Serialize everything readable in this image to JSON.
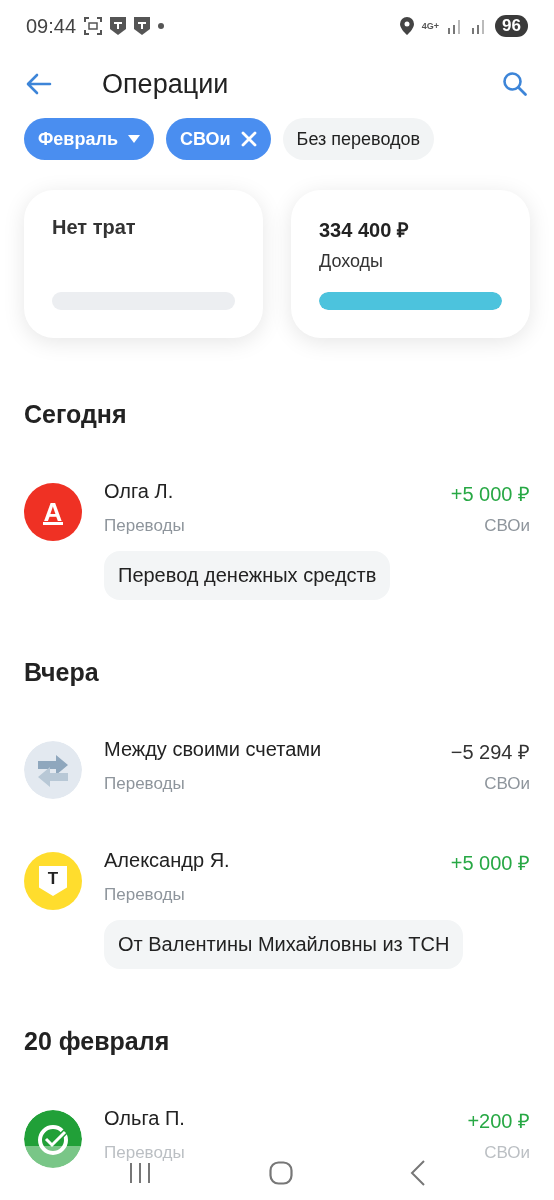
{
  "status_bar": {
    "time": "09:44",
    "network": "4G+",
    "battery": "96"
  },
  "header": {
    "title": "Операции"
  },
  "filters": [
    {
      "label": "Февраль",
      "selected": true,
      "kind": "dropdown"
    },
    {
      "label": "СВОи",
      "selected": true,
      "kind": "removable"
    },
    {
      "label": "Без переводов",
      "selected": false,
      "kind": "toggle"
    }
  ],
  "summary_cards": [
    {
      "title": "Нет трат",
      "level": 0
    },
    {
      "amount": "334 400 ₽",
      "title": "Доходы",
      "level": 1
    }
  ],
  "sections": [
    {
      "title": "Сегодня",
      "transactions": [
        {
          "kind": "alfa",
          "glyph": "А",
          "name": "Олга Л.",
          "category": "Переводы",
          "amount": "+5 000 ₽",
          "income": true,
          "account": "СВОи",
          "note": "Перевод денежных средств"
        }
      ]
    },
    {
      "title": "Вчера",
      "transactions": [
        {
          "kind": "transfer",
          "name": "Между своими счетами",
          "category": "Переводы",
          "amount": "−5 294 ₽",
          "income": false,
          "account": "СВОи"
        },
        {
          "kind": "tbank",
          "glyph": "Т",
          "name": "Александр Я.",
          "category": "Переводы",
          "amount": "+5 000 ₽",
          "income": true,
          "note": "От Валентины Михайловны из ТСН"
        }
      ]
    },
    {
      "title": "20 февраля",
      "transactions": [
        {
          "kind": "sber",
          "name": "Ольга П.",
          "category": "Переводы",
          "amount": "+200 ₽",
          "income": true,
          "account": "СВОи"
        }
      ]
    }
  ]
}
